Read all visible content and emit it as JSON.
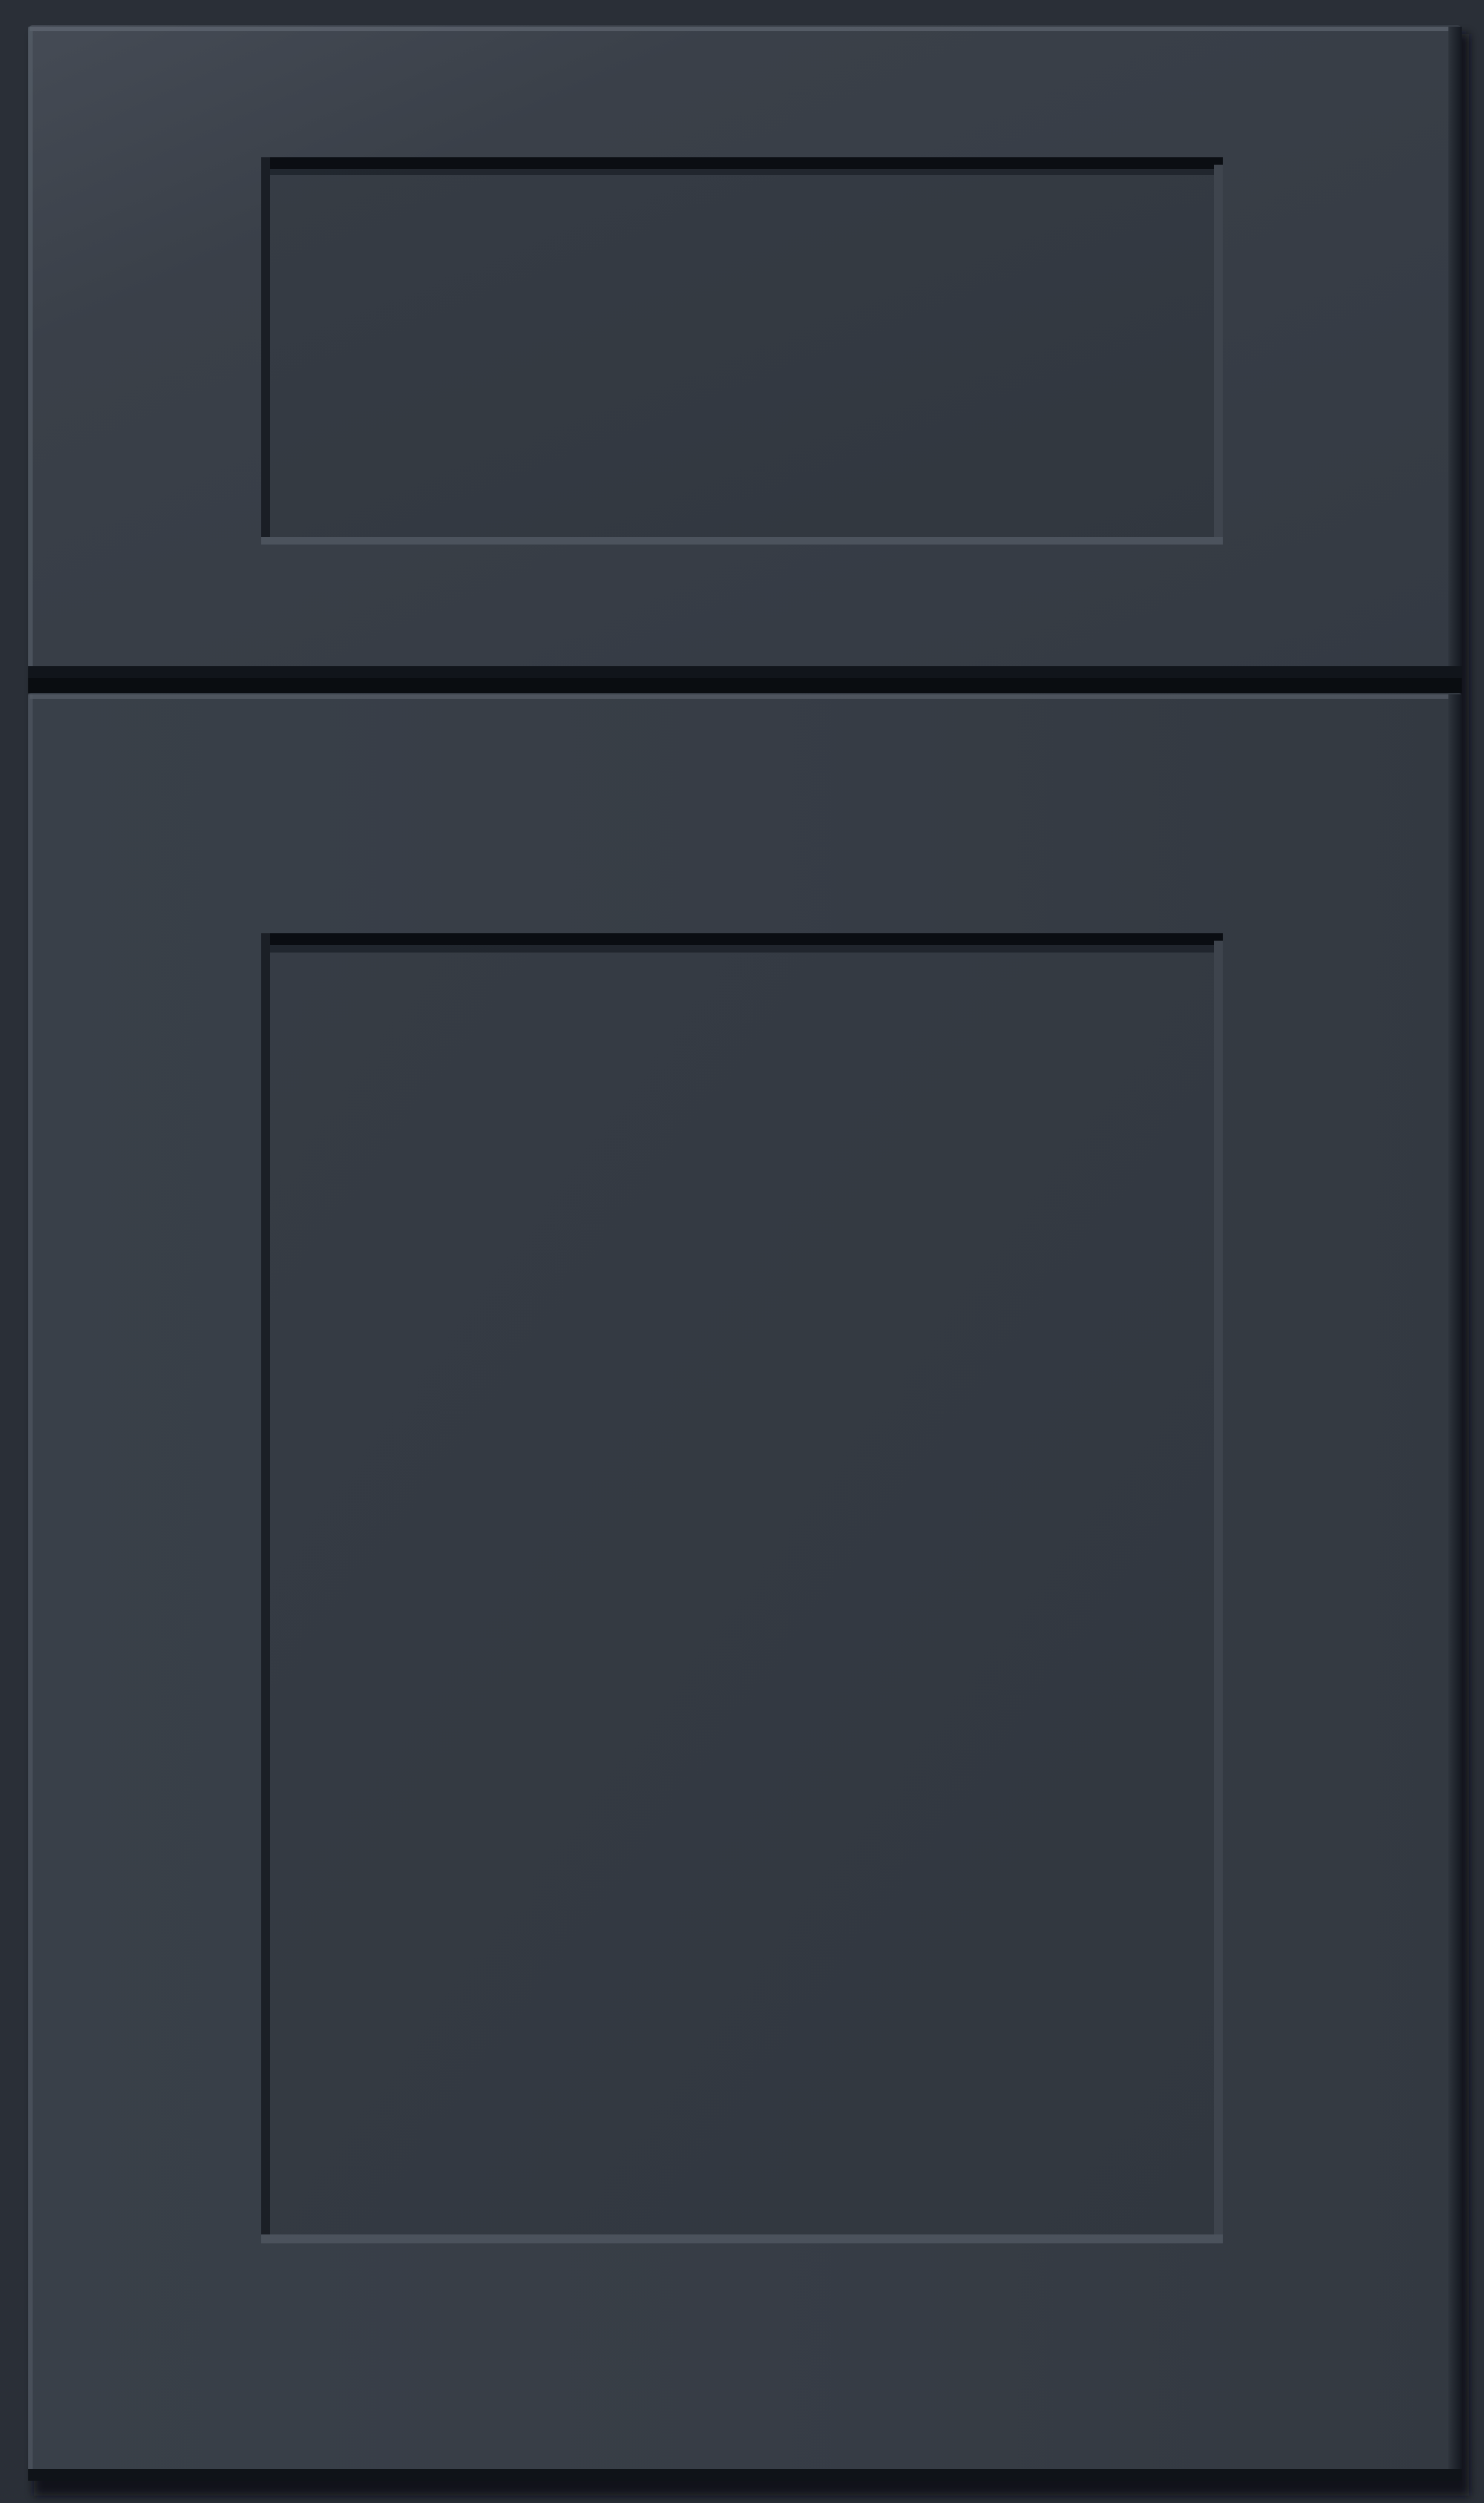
{
  "image": {
    "subject": "cabinet-door",
    "colors": {
      "paint": "#353b44",
      "paint_light": "#3d434c",
      "panel": "#333941",
      "shadow": "#0c0f14",
      "highlight": "#5b626c",
      "background": "#2b3038"
    }
  }
}
